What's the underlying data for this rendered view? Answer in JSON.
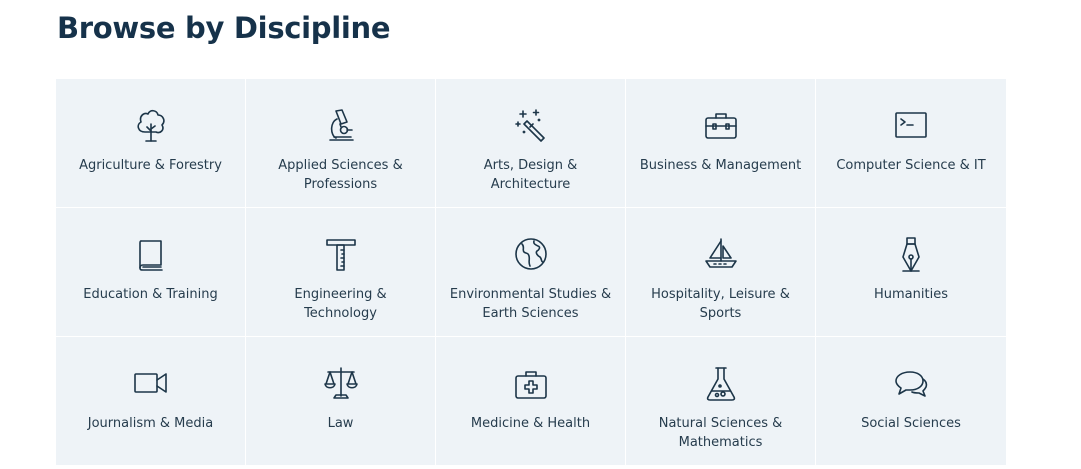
{
  "page": {
    "title": "Browse by Discipline"
  },
  "disciplines": [
    {
      "label": "Agriculture & Forestry",
      "icon": "tree-icon"
    },
    {
      "label": "Applied Sciences & Professions",
      "icon": "microscope-icon"
    },
    {
      "label": "Arts, Design & Architecture",
      "icon": "magic-wand-icon"
    },
    {
      "label": "Business & Management",
      "icon": "briefcase-icon"
    },
    {
      "label": "Computer Science & IT",
      "icon": "terminal-icon"
    },
    {
      "label": "Education & Training",
      "icon": "book-icon"
    },
    {
      "label": "Engineering & Technology",
      "icon": "t-square-icon"
    },
    {
      "label": "Environmental Studies & Earth Sciences",
      "icon": "globe-icon"
    },
    {
      "label": "Hospitality, Leisure & Sports",
      "icon": "sailboat-icon"
    },
    {
      "label": "Humanities",
      "icon": "fountain-pen-icon"
    },
    {
      "label": "Journalism & Media",
      "icon": "video-camera-icon"
    },
    {
      "label": "Law",
      "icon": "scales-icon"
    },
    {
      "label": "Medicine & Health",
      "icon": "first-aid-kit-icon"
    },
    {
      "label": "Natural Sciences & Mathematics",
      "icon": "flask-icon"
    },
    {
      "label": "Social Sciences",
      "icon": "chat-bubbles-icon"
    }
  ],
  "colors": {
    "tile_background": "#eef3f7",
    "title": "#16324a",
    "icon_stroke": "#1c3548"
  }
}
